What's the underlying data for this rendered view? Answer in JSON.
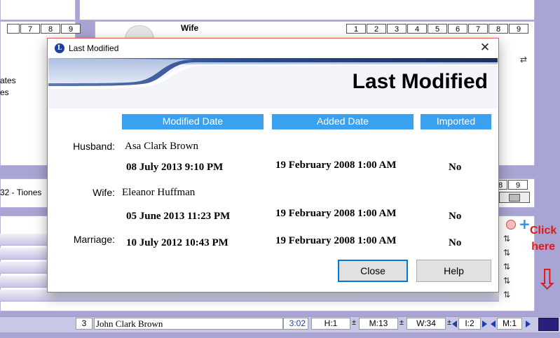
{
  "background": {
    "left_numbers": [
      "7",
      "8",
      "9"
    ],
    "wife_panel": {
      "label": "Wife",
      "numbers": [
        "1",
        "2",
        "3",
        "4",
        "5",
        "6",
        "7",
        "8",
        "9"
      ]
    },
    "left_text_1": "ates",
    "left_text_2": "es",
    "mid_left_text": "32 - Tiones",
    "mid_right_numbers": [
      "8",
      "9"
    ]
  },
  "statusbar": {
    "count": "3",
    "person": "John Clark Brown",
    "time": "3:02",
    "h": "H:1",
    "m": "M:13",
    "w": "W:34",
    "i": "I:2",
    "m2": "M:1",
    "pm1": "±",
    "pm2": "±",
    "pm3": "±"
  },
  "annotation": {
    "line1": "Click",
    "line2": "here",
    "arrow": "⇩"
  },
  "dialog": {
    "window_title": "Last Modified",
    "icon_letter": "L",
    "close_glyph": "✕",
    "banner_title": "Last Modified",
    "columns": {
      "modified": "Modified Date",
      "added": "Added Date",
      "imported": "Imported"
    },
    "husband": {
      "label": "Husband:",
      "name": "Asa Clark Brown",
      "modified": "08 July 2013 9:10 PM",
      "added": "19 February 2008 1:00 AM",
      "imported": "No"
    },
    "wife": {
      "label": "Wife:",
      "name": "Eleanor Huffman",
      "modified": "05 June 2013 11:23 PM",
      "added": "19 February 2008 1:00 AM",
      "imported": "No"
    },
    "marriage": {
      "label": "Marriage:",
      "modified": "10 July 2012 10:43 PM",
      "added": "19 February 2008 1:00 AM",
      "imported": "No"
    },
    "buttons": {
      "close": "Close",
      "help": "Help"
    }
  },
  "colors": {
    "header_blue": "#3aa0f0",
    "banner_dark": "#2a3f7a",
    "accent_red": "#e01818"
  }
}
